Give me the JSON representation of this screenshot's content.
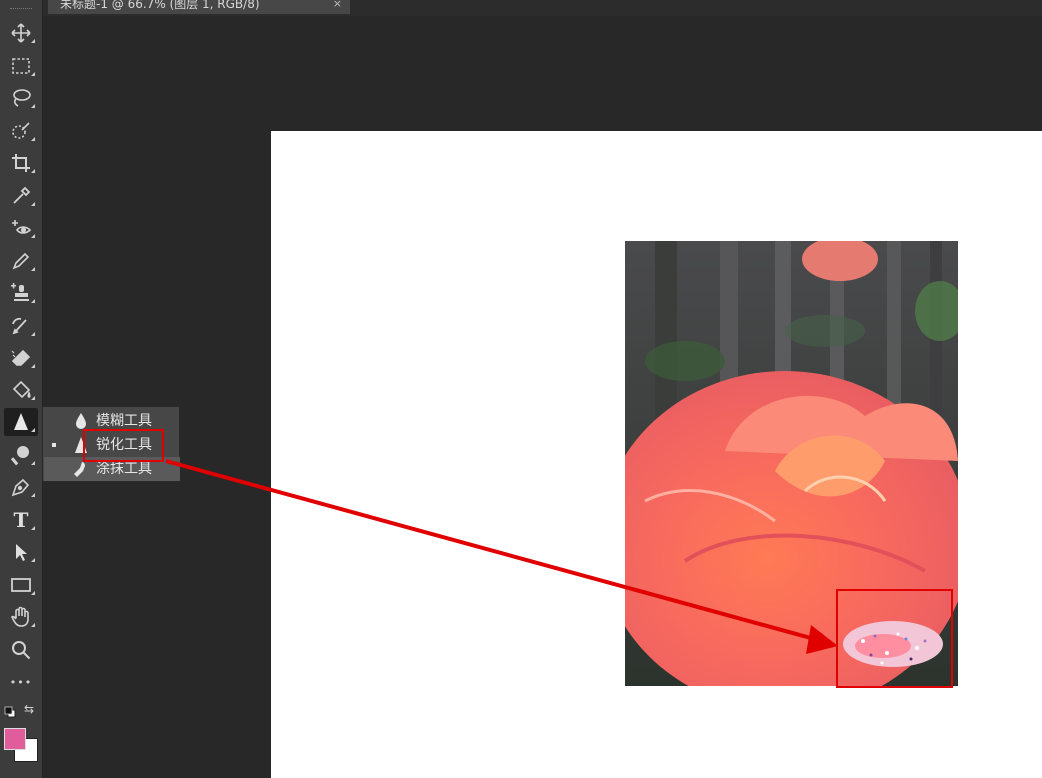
{
  "document_tab": {
    "title": "未标题-1 @ 66.7% (图层 1, RGB/8)",
    "close_glyph": "×"
  },
  "toolbar": {
    "tools": [
      {
        "name": "move-tool",
        "icon": "move-icon"
      },
      {
        "name": "marquee-tool",
        "icon": "rect-marquee-icon"
      },
      {
        "name": "lasso-tool",
        "icon": "lasso-icon"
      },
      {
        "name": "quick-selection-tool",
        "icon": "quick-selection-icon"
      },
      {
        "name": "crop-tool",
        "icon": "crop-icon"
      },
      {
        "name": "eyedropper-tool",
        "icon": "eyedropper-icon"
      },
      {
        "name": "red-eye-tool",
        "icon": "red-eye-icon"
      },
      {
        "name": "pencil-tool",
        "icon": "pencil-icon"
      },
      {
        "name": "clone-stamp-tool",
        "icon": "stamp-icon"
      },
      {
        "name": "history-brush-tool",
        "icon": "history-brush-icon"
      },
      {
        "name": "eraser-tool",
        "icon": "eraser-icon"
      },
      {
        "name": "paint-bucket-tool",
        "icon": "paint-bucket-icon"
      },
      {
        "name": "sharpen-tool",
        "icon": "sharpen-icon",
        "active": true
      },
      {
        "name": "dodge-tool",
        "icon": "dodge-icon"
      },
      {
        "name": "pen-tool",
        "icon": "pen-icon"
      },
      {
        "name": "type-tool",
        "icon": "type-icon"
      },
      {
        "name": "path-selection-tool",
        "icon": "arrow-icon"
      },
      {
        "name": "rectangle-tool",
        "icon": "rectangle-icon"
      },
      {
        "name": "hand-tool",
        "icon": "hand-icon"
      },
      {
        "name": "zoom-tool",
        "icon": "zoom-icon"
      },
      {
        "name": "more-tools",
        "icon": "ellipsis-icon"
      }
    ],
    "type_glyph": "T",
    "more_glyph": "•••",
    "swap_glyph": "⇆",
    "foreground_color": "#e05c9a",
    "background_color": "#ffffff"
  },
  "flyout": {
    "items": [
      {
        "label": "模糊工具",
        "icon": "blur-drop-icon",
        "selected": false
      },
      {
        "label": "锐化工具",
        "icon": "sharpen-triangle-icon",
        "selected": true
      },
      {
        "label": "涂抹工具",
        "icon": "smudge-finger-icon",
        "selected": false
      }
    ]
  },
  "annotation": {
    "color": "#e00000",
    "highlight_target": "锐化工具",
    "result_region": "sharpened-noise-patch"
  }
}
